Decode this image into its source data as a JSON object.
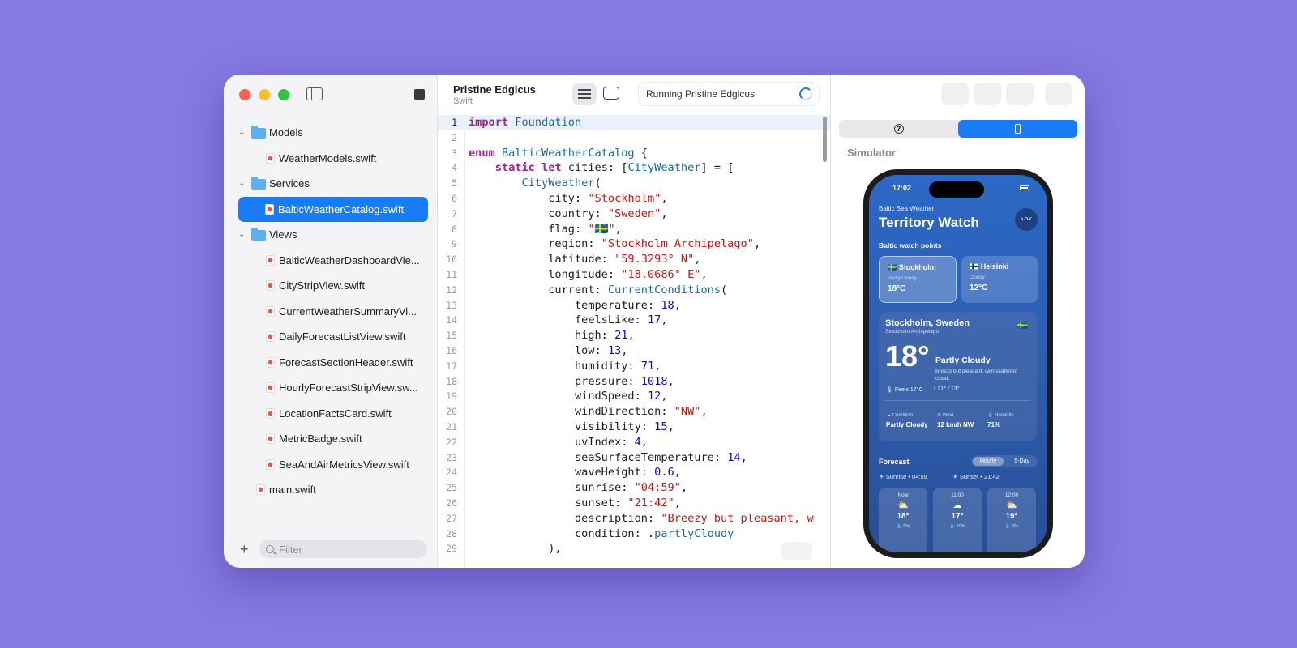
{
  "sidebar": {
    "items": [
      {
        "kind": "folder",
        "label": "Models"
      },
      {
        "kind": "file",
        "label": "WeatherModels.swift"
      },
      {
        "kind": "folder",
        "label": "Services"
      },
      {
        "kind": "file",
        "label": "BalticWeatherCatalog.swift",
        "selected": true
      },
      {
        "kind": "folder",
        "label": "Views"
      },
      {
        "kind": "file",
        "label": "BalticWeatherDashboardVie..."
      },
      {
        "kind": "file",
        "label": "CityStripView.swift"
      },
      {
        "kind": "file",
        "label": "CurrentWeatherSummaryVi..."
      },
      {
        "kind": "file",
        "label": "DailyForecastListView.swift"
      },
      {
        "kind": "file",
        "label": "ForecastSectionHeader.swift"
      },
      {
        "kind": "file",
        "label": "HourlyForecastStripView.sw..."
      },
      {
        "kind": "file",
        "label": "LocationFactsCard.swift"
      },
      {
        "kind": "file",
        "label": "MetricBadge.swift"
      },
      {
        "kind": "file",
        "label": "SeaAndAirMetricsView.swift"
      },
      {
        "kind": "file",
        "label": "main.swift"
      }
    ],
    "filter_placeholder": "Filter"
  },
  "editor": {
    "project_name": "Pristine Edgicus",
    "project_lang": "Swift",
    "run_status": "Running Pristine Edgicus",
    "lines": [
      [
        [
          "kw",
          "import"
        ],
        [
          "t",
          " "
        ],
        [
          "ty",
          "Foundation"
        ]
      ],
      [],
      [
        [
          "kw",
          "enum"
        ],
        [
          "t",
          " "
        ],
        [
          "ty",
          "BalticWeatherCatalog"
        ],
        [
          "t",
          " {"
        ]
      ],
      [
        [
          "t",
          "    "
        ],
        [
          "kw",
          "static let"
        ],
        [
          "t",
          " cities: ["
        ],
        [
          "ty",
          "CityWeather"
        ],
        [
          "t",
          "] = ["
        ]
      ],
      [
        [
          "t",
          "        "
        ],
        [
          "ty",
          "CityWeather"
        ],
        [
          "t",
          "("
        ]
      ],
      [
        [
          "t",
          "            city: "
        ],
        [
          "st",
          "\"Stockholm\""
        ],
        [
          "t",
          ","
        ]
      ],
      [
        [
          "t",
          "            country: "
        ],
        [
          "st",
          "\"Sweden\""
        ],
        [
          "t",
          ","
        ]
      ],
      [
        [
          "t",
          "            flag: "
        ],
        [
          "st",
          "\"🇸🇪\""
        ],
        [
          "t",
          ","
        ]
      ],
      [
        [
          "t",
          "            region: "
        ],
        [
          "st",
          "\"Stockholm Archipelago\""
        ],
        [
          "t",
          ","
        ]
      ],
      [
        [
          "t",
          "            latitude: "
        ],
        [
          "st",
          "\"59.3293° N\""
        ],
        [
          "t",
          ","
        ]
      ],
      [
        [
          "t",
          "            longitude: "
        ],
        [
          "st",
          "\"18.0686° E\""
        ],
        [
          "t",
          ","
        ]
      ],
      [
        [
          "t",
          "            current: "
        ],
        [
          "ty",
          "CurrentConditions"
        ],
        [
          "t",
          "("
        ]
      ],
      [
        [
          "t",
          "                temperature: "
        ],
        [
          "nu",
          "18"
        ],
        [
          "t",
          ","
        ]
      ],
      [
        [
          "t",
          "                feelsLike: "
        ],
        [
          "nu",
          "17"
        ],
        [
          "t",
          ","
        ]
      ],
      [
        [
          "t",
          "                high: "
        ],
        [
          "nu",
          "21"
        ],
        [
          "t",
          ","
        ]
      ],
      [
        [
          "t",
          "                low: "
        ],
        [
          "nu",
          "13"
        ],
        [
          "t",
          ","
        ]
      ],
      [
        [
          "t",
          "                humidity: "
        ],
        [
          "nu",
          "71"
        ],
        [
          "t",
          ","
        ]
      ],
      [
        [
          "t",
          "                pressure: "
        ],
        [
          "nu",
          "1018"
        ],
        [
          "t",
          ","
        ]
      ],
      [
        [
          "t",
          "                windSpeed: "
        ],
        [
          "nu",
          "12"
        ],
        [
          "t",
          ","
        ]
      ],
      [
        [
          "t",
          "                windDirection: "
        ],
        [
          "st",
          "\"NW\""
        ],
        [
          "t",
          ","
        ]
      ],
      [
        [
          "t",
          "                visibility: "
        ],
        [
          "nu",
          "15"
        ],
        [
          "t",
          ","
        ]
      ],
      [
        [
          "t",
          "                uvIndex: "
        ],
        [
          "nu",
          "4"
        ],
        [
          "t",
          ","
        ]
      ],
      [
        [
          "t",
          "                seaSurfaceTemperature: "
        ],
        [
          "nu",
          "14"
        ],
        [
          "t",
          ","
        ]
      ],
      [
        [
          "t",
          "                waveHeight: "
        ],
        [
          "nu",
          "0.6"
        ],
        [
          "t",
          ","
        ]
      ],
      [
        [
          "t",
          "                sunrise: "
        ],
        [
          "st",
          "\"04:59\""
        ],
        [
          "t",
          ","
        ]
      ],
      [
        [
          "t",
          "                sunset: "
        ],
        [
          "st",
          "\"21:42\""
        ],
        [
          "t",
          ","
        ]
      ],
      [
        [
          "t",
          "                description: "
        ],
        [
          "st",
          "\"Breezy but pleasant, w"
        ]
      ],
      [
        [
          "t",
          "                condition: ."
        ],
        [
          "ty",
          "partlyCloudy"
        ]
      ],
      [
        [
          "t",
          "            ),"
        ]
      ]
    ]
  },
  "preview": {
    "label": "Simulator",
    "phone": {
      "time": "17:02",
      "app_name": "Baltic Sea Weather",
      "title": "Territory Watch",
      "section": "Baltic watch points",
      "cities": [
        {
          "flag": "🇸🇪",
          "name": "Stockholm",
          "cond": "Partly Cloudy",
          "temp": "18°C"
        },
        {
          "flag": "🇫🇮",
          "name": "Helsinki",
          "cond": "Cloudy",
          "temp": "12°C"
        }
      ],
      "main": {
        "city": "Stockholm, Sweden",
        "region": "Stockholm Archipelago",
        "flag": "🇸🇪",
        "temp": "18°",
        "condition": "Partly Cloudy",
        "desc": "Breezy but pleasant, with scattered cloud.",
        "feels": "Feels 17°C",
        "hilo": "21° / 13°",
        "stats": [
          {
            "label": "Condition",
            "value": "Partly Cloudy"
          },
          {
            "label": "Wind",
            "value": "12 km/h NW"
          },
          {
            "label": "Humidity",
            "value": "71%"
          }
        ]
      },
      "forecast_title": "Forecast",
      "toggle_on": "Hourly",
      "toggle_off": "5-Day",
      "sunrise": "Sunrise • 04:59",
      "sunset": "Sunset • 21:42",
      "hours": [
        {
          "h": "Now",
          "icon": "⛅",
          "t": "18°",
          "p": "💧 5%"
        },
        {
          "h": "11:00",
          "icon": "☁",
          "t": "17°",
          "p": "💧 10%"
        },
        {
          "h": "12:00",
          "icon": "⛅",
          "t": "19°",
          "p": "💧 5%"
        }
      ]
    }
  }
}
